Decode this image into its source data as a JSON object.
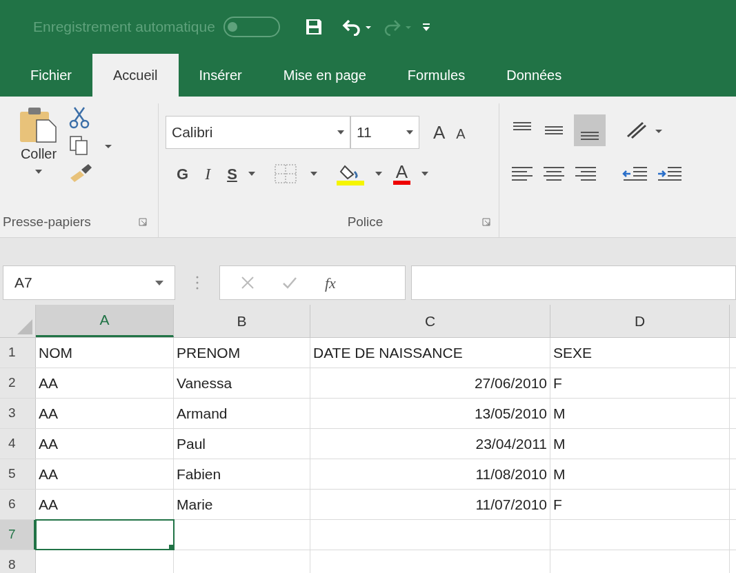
{
  "title_bar": {
    "autosave_label": "Enregistrement automatique",
    "autosave_on": false
  },
  "tabs": [
    {
      "label": "Fichier",
      "selected": false
    },
    {
      "label": "Accueil",
      "selected": true
    },
    {
      "label": "Insérer",
      "selected": false
    },
    {
      "label": "Mise en page",
      "selected": false
    },
    {
      "label": "Formules",
      "selected": false
    },
    {
      "label": "Données",
      "selected": false
    }
  ],
  "ribbon": {
    "clipboard": {
      "paste_label": "Coller",
      "group_label": "Presse-papiers"
    },
    "font": {
      "font_name": "Calibri",
      "font_size": "11",
      "grow": "A",
      "shrink": "A",
      "bold": "G",
      "italic": "I",
      "underline": "S",
      "font_color": "A",
      "group_label": "Police"
    }
  },
  "formula_bar": {
    "name_box": "A7",
    "function_label": "fx"
  },
  "sheet": {
    "columns": [
      {
        "label": "A",
        "selected": true
      },
      {
        "label": "B",
        "selected": false
      },
      {
        "label": "C",
        "selected": false
      },
      {
        "label": "D",
        "selected": false
      }
    ],
    "rows": [
      {
        "label": "1",
        "selected": false,
        "cells": [
          {
            "text": "NOM",
            "kind": "text"
          },
          {
            "text": "PRENOM",
            "kind": "text"
          },
          {
            "text": "DATE DE NAISSANCE",
            "kind": "text"
          },
          {
            "text": "SEXE",
            "kind": "text"
          }
        ]
      },
      {
        "label": "2",
        "selected": false,
        "cells": [
          {
            "text": "AA",
            "kind": "text"
          },
          {
            "text": "Vanessa",
            "kind": "text"
          },
          {
            "text": "27/06/2010",
            "kind": "number"
          },
          {
            "text": "F",
            "kind": "text"
          }
        ]
      },
      {
        "label": "3",
        "selected": false,
        "cells": [
          {
            "text": "AA",
            "kind": "text"
          },
          {
            "text": "Armand",
            "kind": "text"
          },
          {
            "text": "13/05/2010",
            "kind": "number"
          },
          {
            "text": "M",
            "kind": "text"
          }
        ]
      },
      {
        "label": "4",
        "selected": false,
        "cells": [
          {
            "text": "AA",
            "kind": "text"
          },
          {
            "text": "Paul",
            "kind": "text"
          },
          {
            "text": "23/04/2011",
            "kind": "number"
          },
          {
            "text": "M",
            "kind": "text"
          }
        ]
      },
      {
        "label": "5",
        "selected": false,
        "cells": [
          {
            "text": "AA",
            "kind": "text"
          },
          {
            "text": "Fabien",
            "kind": "text"
          },
          {
            "text": "11/08/2010",
            "kind": "number"
          },
          {
            "text": "M",
            "kind": "text"
          }
        ]
      },
      {
        "label": "6",
        "selected": false,
        "cells": [
          {
            "text": "AA",
            "kind": "text"
          },
          {
            "text": "Marie",
            "kind": "text"
          },
          {
            "text": "11/07/2010",
            "kind": "number"
          },
          {
            "text": "F",
            "kind": "text"
          }
        ]
      },
      {
        "label": "7",
        "selected": true
      },
      {
        "label": "8",
        "selected": false
      }
    ]
  }
}
